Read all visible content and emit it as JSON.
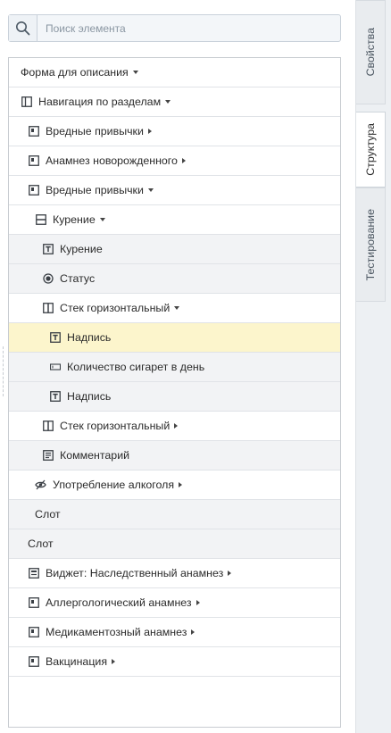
{
  "search": {
    "placeholder": "Поиск элемента"
  },
  "tabs": [
    {
      "label": "Свойства"
    },
    {
      "label": "Структура"
    },
    {
      "label": "Тестирование"
    }
  ],
  "tree": [
    {
      "label": "Форма для описания",
      "icon": "none",
      "caret": "down",
      "indent": 13,
      "bg": "white"
    },
    {
      "label": "Навигация по разделам",
      "icon": "panel-layout-icon",
      "caret": "down",
      "indent": 13,
      "bg": "white"
    },
    {
      "label": "Вредные привычки",
      "icon": "section-icon",
      "caret": "right",
      "indent": 21,
      "bg": "white"
    },
    {
      "label": "Анамнез новорожденного",
      "icon": "section-icon",
      "caret": "right",
      "indent": 21,
      "bg": "white"
    },
    {
      "label": "Вредные привычки",
      "icon": "section-icon",
      "caret": "down",
      "indent": 21,
      "bg": "white"
    },
    {
      "label": "Курение",
      "icon": "vertical-stack-icon",
      "caret": "down",
      "indent": 29,
      "bg": "white"
    },
    {
      "label": "Курение",
      "icon": "text-label-icon",
      "caret": "none",
      "indent": 37,
      "bg": "alt"
    },
    {
      "label": "Статус",
      "icon": "radio-icon",
      "caret": "none",
      "indent": 37,
      "bg": "alt"
    },
    {
      "label": "Стек горизонтальный",
      "icon": "horizontal-stack-icon",
      "caret": "down",
      "indent": 37,
      "bg": "white"
    },
    {
      "label": "Надпись",
      "icon": "text-label-icon",
      "caret": "none",
      "indent": 45,
      "bg": "selected"
    },
    {
      "label": "Количество сигарет в день",
      "icon": "input-field-icon",
      "caret": "none",
      "indent": 45,
      "bg": "alt"
    },
    {
      "label": "Надпись",
      "icon": "text-label-icon",
      "caret": "none",
      "indent": 45,
      "bg": "alt"
    },
    {
      "label": "Стек горизонтальный",
      "icon": "horizontal-stack-icon",
      "caret": "right",
      "indent": 37,
      "bg": "white"
    },
    {
      "label": "Комментарий",
      "icon": "text-area-icon",
      "caret": "none",
      "indent": 37,
      "bg": "alt"
    },
    {
      "label": "Употребление алкоголя",
      "icon": "eye-hidden-icon",
      "caret": "right",
      "indent": 29,
      "bg": "white"
    },
    {
      "label": "Слот",
      "icon": "none",
      "caret": "none",
      "indent": 29,
      "bg": "alt"
    },
    {
      "label": "Слот",
      "icon": "none",
      "caret": "none",
      "indent": 21,
      "bg": "alt"
    },
    {
      "label": "Виджет: Наследственный анамнез",
      "icon": "widget-icon",
      "caret": "right",
      "indent": 21,
      "bg": "white"
    },
    {
      "label": "Аллергологический анамнез",
      "icon": "section-icon",
      "caret": "right",
      "indent": 21,
      "bg": "white"
    },
    {
      "label": "Медикаментозный анамнез",
      "icon": "section-icon",
      "caret": "right",
      "indent": 21,
      "bg": "white"
    },
    {
      "label": "Вакцинация",
      "icon": "section-icon",
      "caret": "right",
      "indent": 21,
      "bg": "white"
    }
  ]
}
